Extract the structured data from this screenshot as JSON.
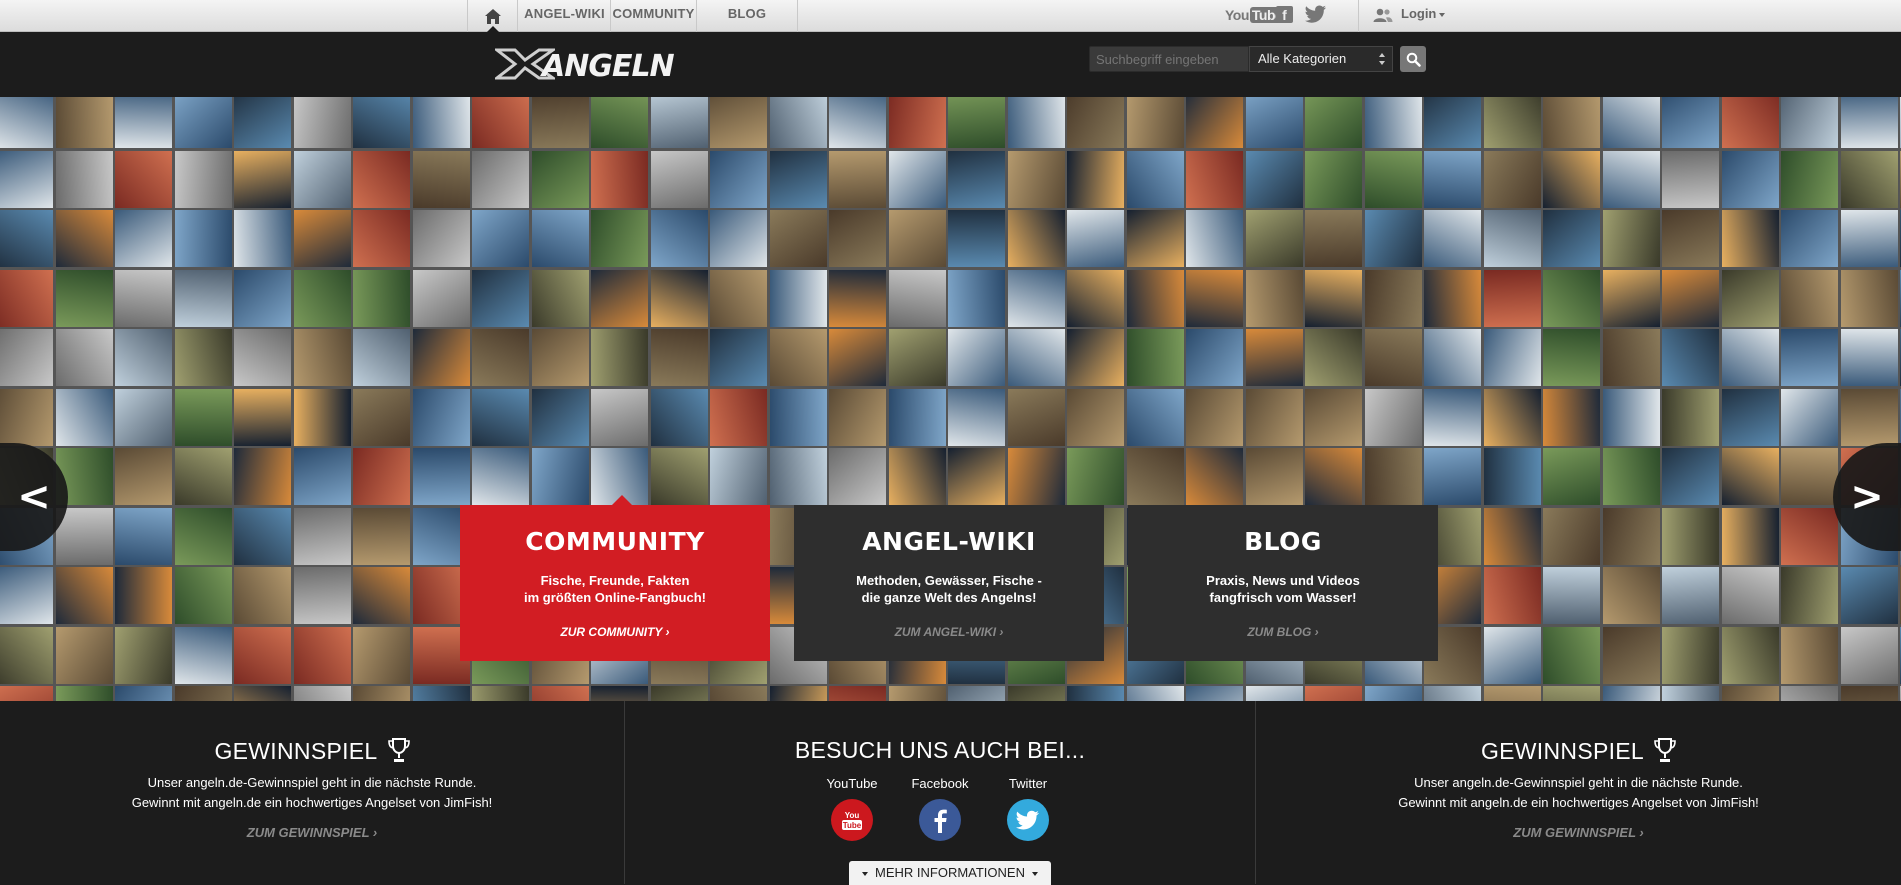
{
  "nav": {
    "home_icon": "home-icon",
    "links": [
      "ANGEL-WIKI",
      "COMMUNITY",
      "BLOG"
    ],
    "youtube_label": "YouTube",
    "login_label": "Login"
  },
  "header": {
    "logo_text": "ANGELN",
    "search": {
      "placeholder": "Suchbegriff eingeben",
      "category": "Alle Kategorien"
    }
  },
  "panels": {
    "community": {
      "title": "COMMUNITY",
      "line1": "Fische, Freunde, Fakten",
      "line2": "im größten Online-Fangbuch!",
      "link": "ZUR COMMUNITY ›"
    },
    "wiki": {
      "title": "ANGEL-WIKI",
      "line1": "Methoden, Gewässer, Fische -",
      "line2": "die ganze Welt des Angelns!",
      "link": "ZUM ANGEL-WIKI ›"
    },
    "blog": {
      "title": "BLOG",
      "line1": "Praxis, News und Videos",
      "line2": "fangfrisch vom Wasser!",
      "link": "ZUM BLOG ›"
    }
  },
  "footer": {
    "left": {
      "title": "GEWINNSPIEL",
      "line1": "Unser angeln.de-Gewinnspiel geht in die nächste Runde.",
      "line2": "Gewinnt mit angeln.de ein hochwertiges Angelset von JimFish!",
      "link": "ZUM GEWINNSPIEL ›"
    },
    "center": {
      "title": "BESUCH UNS AUCH BEI...",
      "youtube": "YouTube",
      "facebook": "Facebook",
      "twitter": "Twitter",
      "more": "MEHR INFORMATIONEN"
    },
    "right": {
      "title": "GEWINNSPIEL",
      "line1": "Unser angeln.de-Gewinnspiel geht in die nächste Runde.",
      "line2": "Gewinnt mit angeln.de ein hochwertiges Angelset von JimFish!",
      "link": "ZUM GEWINNSPIEL ›"
    }
  },
  "colors": {
    "accent_red": "#d21d23",
    "dark_bg": "#1c1c1c",
    "panel_dark": "#2e2e2e",
    "youtube": "#cc181e",
    "facebook": "#3b5998",
    "twitter": "#33aadd"
  }
}
